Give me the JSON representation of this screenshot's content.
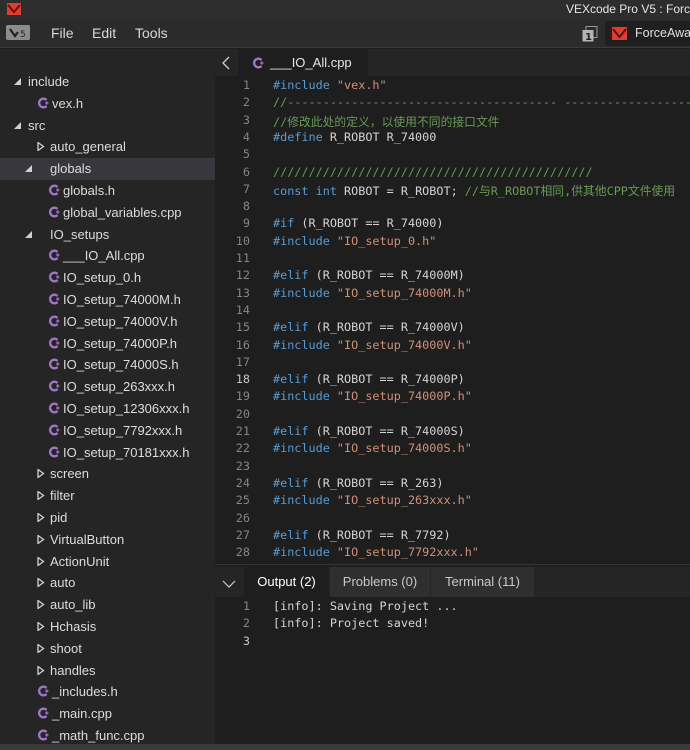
{
  "window": {
    "title": "VEXcode Pro V5 : Forc"
  },
  "menubar": {
    "logo": "vex-v5-logo",
    "items": [
      "File",
      "Edit",
      "Tools"
    ],
    "slot_number": "1",
    "project_name": "ForceAwake"
  },
  "sidebar": {
    "tree": [
      {
        "type": "folder",
        "label": "include",
        "depth": 0,
        "expanded": true
      },
      {
        "type": "file",
        "label": "vex.h",
        "depth": 1
      },
      {
        "type": "folder",
        "label": "src",
        "depth": 0,
        "expanded": true
      },
      {
        "type": "folder",
        "label": "auto_general",
        "depth": 1,
        "expanded": false
      },
      {
        "type": "folder",
        "label": "globals",
        "depth": 1,
        "expanded": true,
        "selected": true
      },
      {
        "type": "file",
        "label": "globals.h",
        "depth": 2
      },
      {
        "type": "file",
        "label": "global_variables.cpp",
        "depth": 2
      },
      {
        "type": "folder",
        "label": "IO_setups",
        "depth": 1,
        "expanded": true
      },
      {
        "type": "file",
        "label": "___IO_All.cpp",
        "depth": 2
      },
      {
        "type": "file",
        "label": "IO_setup_0.h",
        "depth": 2
      },
      {
        "type": "file",
        "label": "IO_setup_74000M.h",
        "depth": 2
      },
      {
        "type": "file",
        "label": "IO_setup_74000V.h",
        "depth": 2
      },
      {
        "type": "file",
        "label": "IO_setup_74000P.h",
        "depth": 2
      },
      {
        "type": "file",
        "label": "IO_setup_74000S.h",
        "depth": 2
      },
      {
        "type": "file",
        "label": "IO_setup_263xxx.h",
        "depth": 2
      },
      {
        "type": "file",
        "label": "IO_setup_12306xxx.h",
        "depth": 2
      },
      {
        "type": "file",
        "label": "IO_setup_7792xxx.h",
        "depth": 2
      },
      {
        "type": "file",
        "label": "IO_setup_70181xxx.h",
        "depth": 2
      },
      {
        "type": "folder",
        "label": "screen",
        "depth": 1,
        "expanded": false
      },
      {
        "type": "folder",
        "label": "filter",
        "depth": 1,
        "expanded": false
      },
      {
        "type": "folder",
        "label": "pid",
        "depth": 1,
        "expanded": false
      },
      {
        "type": "folder",
        "label": "VirtualButton",
        "depth": 1,
        "expanded": false
      },
      {
        "type": "folder",
        "label": "ActionUnit",
        "depth": 1,
        "expanded": false
      },
      {
        "type": "folder",
        "label": "auto",
        "depth": 1,
        "expanded": false
      },
      {
        "type": "folder",
        "label": "auto_lib",
        "depth": 1,
        "expanded": false
      },
      {
        "type": "folder",
        "label": "Hchasis",
        "depth": 1,
        "expanded": false
      },
      {
        "type": "folder",
        "label": "shoot",
        "depth": 1,
        "expanded": false
      },
      {
        "type": "folder",
        "label": "handles",
        "depth": 1,
        "expanded": false
      },
      {
        "type": "file",
        "label": "_includes.h",
        "depth": 1
      },
      {
        "type": "file",
        "label": "_main.cpp",
        "depth": 1
      },
      {
        "type": "file",
        "label": "_math_func.cpp",
        "depth": 1
      }
    ]
  },
  "editor": {
    "tab_label": "___IO_All.cpp",
    "active_line": 18,
    "lines": [
      [
        {
          "c": "kw",
          "t": "#include "
        },
        {
          "c": "str",
          "t": "\"vex.h\""
        }
      ],
      [
        {
          "c": "cmt",
          "t": "//-------------------------------------- ------------------------"
        }
      ],
      [
        {
          "c": "cmt",
          "t": "//修改此处的定义，以使用不同的接口文件"
        }
      ],
      [
        {
          "c": "kw",
          "t": "#define "
        },
        {
          "c": "plain",
          "t": "R_ROBOT R_74000"
        }
      ],
      [],
      [
        {
          "c": "cmt",
          "t": "/////////////////////////////////////////////"
        }
      ],
      [
        {
          "c": "kw",
          "t": "const "
        },
        {
          "c": "kw",
          "t": "int "
        },
        {
          "c": "plain",
          "t": "ROBOT = R_ROBOT; "
        },
        {
          "c": "cmt",
          "t": "//与R_ROBOT相同,供其他CPP文件使用"
        }
      ],
      [],
      [
        {
          "c": "kw",
          "t": "#if "
        },
        {
          "c": "plain",
          "t": "(R_ROBOT == R_74000)"
        }
      ],
      [
        {
          "c": "kw",
          "t": "#include "
        },
        {
          "c": "str",
          "t": "\"IO_setup_0.h\""
        }
      ],
      [],
      [
        {
          "c": "kw",
          "t": "#elif "
        },
        {
          "c": "plain",
          "t": "(R_ROBOT == R_74000M)"
        }
      ],
      [
        {
          "c": "kw",
          "t": "#include "
        },
        {
          "c": "str",
          "t": "\"IO_setup_74000M.h\""
        }
      ],
      [],
      [
        {
          "c": "kw",
          "t": "#elif "
        },
        {
          "c": "plain",
          "t": "(R_ROBOT == R_74000V)"
        }
      ],
      [
        {
          "c": "kw",
          "t": "#include "
        },
        {
          "c": "str",
          "t": "\"IO_setup_74000V.h\""
        }
      ],
      [],
      [
        {
          "c": "kw",
          "t": "#elif "
        },
        {
          "c": "plain",
          "t": "(R_ROBOT == R_74000P)"
        }
      ],
      [
        {
          "c": "kw",
          "t": "#include "
        },
        {
          "c": "str",
          "t": "\"IO_setup_74000P.h\""
        }
      ],
      [],
      [
        {
          "c": "kw",
          "t": "#elif "
        },
        {
          "c": "plain",
          "t": "(R_ROBOT == R_74000S)"
        }
      ],
      [
        {
          "c": "kw",
          "t": "#include "
        },
        {
          "c": "str",
          "t": "\"IO_setup_74000S.h\""
        }
      ],
      [],
      [
        {
          "c": "kw",
          "t": "#elif "
        },
        {
          "c": "plain",
          "t": "(R_ROBOT == R_263)"
        }
      ],
      [
        {
          "c": "kw",
          "t": "#include "
        },
        {
          "c": "str",
          "t": "\"IO_setup_263xxx.h\""
        }
      ],
      [],
      [
        {
          "c": "kw",
          "t": "#elif "
        },
        {
          "c": "plain",
          "t": "(R_ROBOT == R_7792)"
        }
      ],
      [
        {
          "c": "kw",
          "t": "#include "
        },
        {
          "c": "str",
          "t": "\"IO_setup_7792xxx.h\""
        }
      ]
    ]
  },
  "panel": {
    "tabs": [
      {
        "label": "Output (2)",
        "active": true
      },
      {
        "label": "Problems (0)",
        "active": false
      },
      {
        "label": "Terminal (11)",
        "active": false
      }
    ],
    "active_line": 3,
    "output_lines": [
      "[info]: Saving Project ...",
      "[info]: Project saved!",
      ""
    ]
  },
  "colors": {
    "keyword": "#569cd6",
    "string": "#ce9178",
    "comment": "#6a9955",
    "file_icon": "#a074c4",
    "vex_red": "#e03c31"
  }
}
